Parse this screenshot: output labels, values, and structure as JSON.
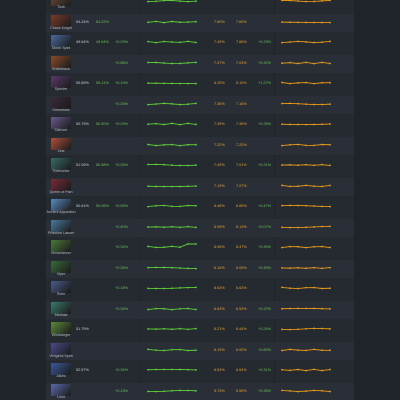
{
  "colors": {
    "win_line": "#5fcf3a",
    "pick_line": "#e89a1a",
    "positive": "#6fc25a",
    "negative": "#e05a4a"
  },
  "heroes": [
    {
      "name": "Tusk",
      "win": "",
      "win_prev": "",
      "delta": "",
      "delta_sign": "pos",
      "pick": "",
      "pick_prev": "",
      "pdelta": "",
      "pdelta_sign": "neg",
      "color": "#6a4a3a"
    },
    {
      "name": "Chaos Knight",
      "win": "54.24%",
      "win_prev": "54.22%",
      "delta": "",
      "delta_sign": "pos",
      "pick": "7.60%",
      "pick_prev": "7.60%",
      "pdelta": "",
      "pdelta_sign": "pos",
      "color": "#7a3a2a"
    },
    {
      "name": "Storm Spirit",
      "win": "49.64%",
      "win_prev": "49.64%",
      "delta": "+0.29%",
      "delta_sign": "pos",
      "pick": "7.49%",
      "pick_prev": "7.66%",
      "pdelta": "+0.23%",
      "pdelta_sign": "pos",
      "color": "#4a6aa0"
    },
    {
      "name": "Bristleback",
      "win": "",
      "win_prev": "",
      "delta": "+0.86%",
      "delta_sign": "pos",
      "pick": "7.37%",
      "pick_prev": "7.03%",
      "pdelta": "+0.32%",
      "pdelta_sign": "pos",
      "color": "#8a4a2a"
    },
    {
      "name": "Spectre",
      "win": "55.89%",
      "win_prev": "55.11%",
      "delta": "+0.19%",
      "delta_sign": "pos",
      "pick": "6.25%",
      "pick_prev": "5.10%",
      "pdelta": "+1.27%",
      "pdelta_sign": "pos",
      "color": "#5a3a6a"
    },
    {
      "name": "Grimstroke",
      "win": "",
      "win_prev": "",
      "delta": "+0.26%",
      "delta_sign": "pos",
      "pick": "7.36%",
      "pick_prev": "7.16%",
      "pdelta": "",
      "pdelta_sign": "pos",
      "color": "#3a2a3a"
    },
    {
      "name": "Silencer",
      "win": "50.79%",
      "win_prev": "50.50%",
      "delta": "+0.29%",
      "delta_sign": "pos",
      "pick": "7.39%",
      "pick_prev": "7.39%",
      "pdelta": "+0.25%",
      "pdelta_sign": "pos",
      "color": "#6a5a8a"
    },
    {
      "name": "Lina",
      "win": "",
      "win_prev": "",
      "delta": "",
      "delta_sign": "neg",
      "pick": "7.22%",
      "pick_prev": "7.22%",
      "pdelta": "",
      "pdelta_sign": "pos",
      "color": "#b0503a"
    },
    {
      "name": "Tidehunter",
      "win": "51.05%",
      "win_prev": "50.58%",
      "delta": "+0.26%",
      "delta_sign": "pos",
      "pick": "7.49%",
      "pick_prev": "7.01%",
      "pdelta": "+0.21%",
      "pdelta_sign": "pos",
      "color": "#3a6a6a"
    },
    {
      "name": "Queen of Pain",
      "win": "",
      "win_prev": "",
      "delta": "",
      "delta_sign": "neg",
      "pick": "7.19%",
      "pick_prev": "7.07%",
      "pdelta": "",
      "pdelta_sign": "neg",
      "color": "#7a2a3a"
    },
    {
      "name": "Ancient Apparition",
      "win": "50.61%",
      "win_prev": "50.06%",
      "delta": "+0.55%",
      "delta_sign": "pos",
      "pick": "6.46%",
      "pick_prev": "6.89%",
      "pdelta": "+0.47%",
      "pdelta_sign": "pos",
      "color": "#5a8ac0"
    },
    {
      "name": "Phantom Lancer",
      "win": "",
      "win_prev": "",
      "delta": "+0.40%",
      "delta_sign": "pos",
      "pick": "6.99%",
      "pick_prev": "6.13%",
      "pdelta": "+0.07%",
      "pdelta_sign": "pos",
      "color": "#4a7aa0"
    },
    {
      "name": "Venomancer",
      "win": "",
      "win_prev": "",
      "delta": "+0.34%",
      "delta_sign": "pos",
      "pick": "6.96%",
      "pick_prev": "6.37%",
      "pdelta": "+0.39%",
      "pdelta_sign": "pos",
      "color": "#4a7a3a"
    },
    {
      "name": "Viper",
      "win": "",
      "win_prev": "",
      "delta": "+0.26%",
      "delta_sign": "pos",
      "pick": "6.16%",
      "pick_prev": "6.09%",
      "pdelta": "+0.39%",
      "pdelta_sign": "pos",
      "color": "#3a6a3a"
    },
    {
      "name": "Sven",
      "win": "",
      "win_prev": "",
      "delta": "+0.18%",
      "delta_sign": "pos",
      "pick": "6.63%",
      "pick_prev": "6.63%",
      "pdelta": "",
      "pdelta_sign": "pos",
      "color": "#4a5a8a"
    },
    {
      "name": "Medusa",
      "win": "",
      "win_prev": "",
      "delta": "+0.34%",
      "delta_sign": "pos",
      "pick": "6.63%",
      "pick_prev": "6.53%",
      "pdelta": "+0.22%",
      "pdelta_sign": "pos",
      "color": "#3a7a6a"
    },
    {
      "name": "Windranger",
      "win": "51.79%",
      "win_prev": "",
      "delta": "",
      "delta_sign": "neg",
      "pick": "6.21%",
      "pick_prev": "6.44%",
      "pdelta": "+0.24%",
      "pdelta_sign": "pos",
      "color": "#5a8a3a"
    },
    {
      "name": "Vengeful Spirit",
      "win": "",
      "win_prev": "",
      "delta": "",
      "delta_sign": "pos",
      "pick": "6.19%",
      "pick_prev": "6.92%",
      "pdelta": "+0.80%",
      "pdelta_sign": "pos",
      "color": "#4a4a8a"
    },
    {
      "name": "Jakiro",
      "win": "52.57%",
      "win_prev": "",
      "delta": "+0.34%",
      "delta_sign": "pos",
      "pick": "6.54%",
      "pick_prev": "6.54%",
      "pdelta": "+0.31%",
      "pdelta_sign": "pos",
      "color": "#3a5a9a"
    },
    {
      "name": "Luna",
      "win": "",
      "win_prev": "",
      "delta": "+0.13%",
      "delta_sign": "pos",
      "pick": "5.73%",
      "pick_prev": "5.59%",
      "pdelta": "+0.35%",
      "pdelta_sign": "pos",
      "color": "#5a6aaa"
    }
  ]
}
